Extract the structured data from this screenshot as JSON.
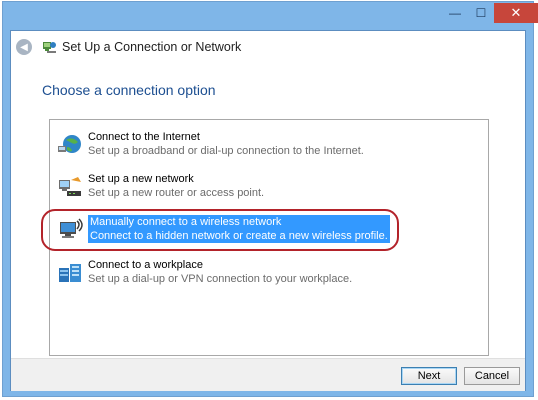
{
  "window": {
    "title": "Set Up a Connection or Network",
    "minimize_glyph": "—",
    "maximize_glyph": "☐",
    "close_glyph": "✕"
  },
  "heading": "Choose a connection option",
  "options": [
    {
      "title": "Connect to the Internet",
      "desc": "Set up a broadband or dial-up connection to the Internet.",
      "icon": "globe-network-icon",
      "selected": false
    },
    {
      "title": "Set up a new network",
      "desc": "Set up a new router or access point.",
      "icon": "router-icon",
      "selected": false
    },
    {
      "title": "Manually connect to a wireless network",
      "desc": "Connect to a hidden network or create a new wireless profile.",
      "icon": "wireless-computer-icon",
      "selected": true
    },
    {
      "title": "Connect to a workplace",
      "desc": "Set up a dial-up or VPN connection to your workplace.",
      "icon": "workplace-icon",
      "selected": false
    }
  ],
  "buttons": {
    "next": "Next",
    "cancel": "Cancel"
  },
  "colors": {
    "selection": "#3399ff",
    "heading": "#1d4f91",
    "annotation_ring": "#b3232a",
    "close_button": "#c7463b"
  }
}
